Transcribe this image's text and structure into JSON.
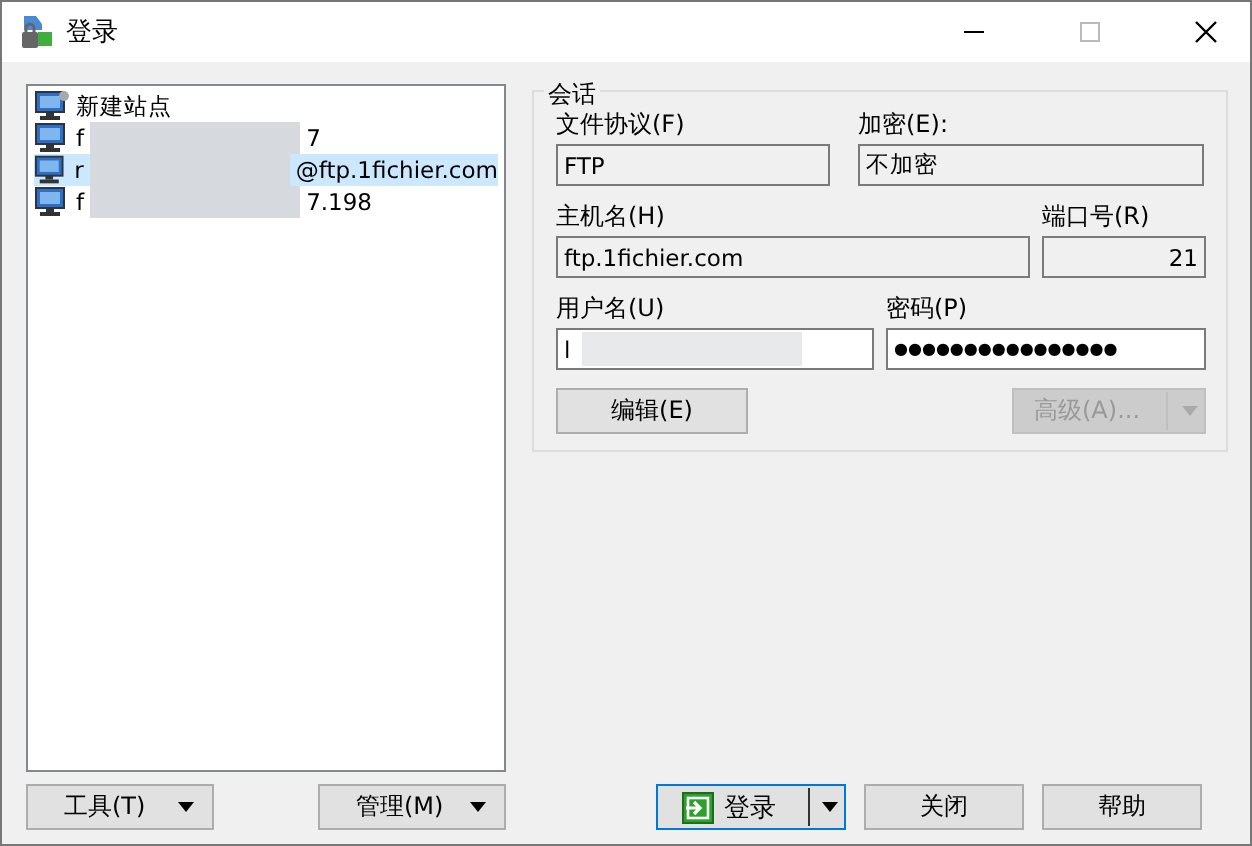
{
  "window": {
    "title": "登录"
  },
  "sites": [
    {
      "kind": "new",
      "text": "新建站点",
      "selected": false
    },
    {
      "kind": "site",
      "text_start": "f",
      "text_end": "7",
      "selected": false
    },
    {
      "kind": "site",
      "text_start": "r",
      "text_end": "@ftp.1fichier.com",
      "selected": true
    },
    {
      "kind": "site",
      "text_start": "f",
      "text_end": "7.198",
      "selected": false
    }
  ],
  "left_buttons": [
    {
      "label": "工具(T)"
    },
    {
      "label": "管理(M)"
    }
  ],
  "session": {
    "title": "会话",
    "protocol": {
      "label": "文件协议(F)",
      "value": "FTP"
    },
    "encryption": {
      "label": "加密(E):",
      "value": "不加密"
    },
    "host": {
      "label": "主机名(H)",
      "value": "ftp.1fichier.com"
    },
    "port": {
      "label": "端口号(R)",
      "value": "21"
    },
    "user": {
      "label": "用户名(U)",
      "value": "l"
    },
    "password": {
      "label": "密码(P)",
      "value": "●●●●●●●●●●●●●●●●"
    },
    "edit_button": {
      "label": "编辑(E)",
      "disabled": false
    },
    "advanced_button": {
      "label": "高级(A)...",
      "disabled": true
    }
  },
  "buttons": [
    {
      "kind": "login",
      "label": "登录"
    },
    {
      "kind": "plain",
      "label": "关闭"
    },
    {
      "kind": "plain",
      "label": "帮助"
    }
  ]
}
